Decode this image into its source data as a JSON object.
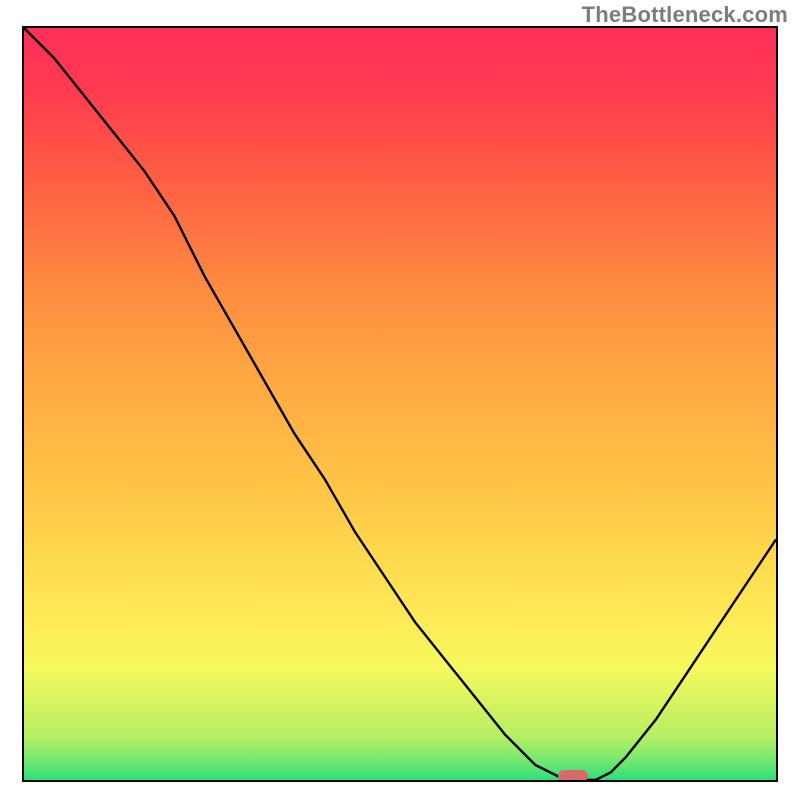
{
  "watermark": "TheBottleneck.com",
  "colors": {
    "curve": "#000000",
    "marker": "#d46a6a",
    "border": "#000000"
  },
  "chart_data": {
    "type": "line",
    "title": "",
    "xlabel": "",
    "ylabel": "",
    "xlim": [
      0,
      100
    ],
    "ylim": [
      0,
      100
    ],
    "x": [
      0,
      4,
      8,
      12,
      16,
      20,
      24,
      28,
      32,
      36,
      40,
      44,
      48,
      52,
      56,
      60,
      64,
      66,
      68,
      70,
      72,
      74,
      76,
      78,
      80,
      84,
      88,
      92,
      96,
      100
    ],
    "y": [
      100,
      96,
      91,
      86,
      81,
      75,
      67,
      60,
      53,
      46,
      40,
      33,
      27,
      21,
      16,
      11,
      6,
      4,
      2,
      1,
      0,
      0,
      0,
      1,
      3,
      8,
      14,
      20,
      26,
      32
    ],
    "marker": {
      "x": 73,
      "width": 4,
      "y": 0
    },
    "gradient_stops": [
      {
        "pos": 0,
        "color": "#2de07a"
      },
      {
        "pos": 3,
        "color": "#7ee96e"
      },
      {
        "pos": 6,
        "color": "#b9ef64"
      },
      {
        "pos": 15,
        "color": "#f6f95d"
      },
      {
        "pos": 22,
        "color": "#ffe956"
      },
      {
        "pos": 30,
        "color": "#ffd84d"
      },
      {
        "pos": 40,
        "color": "#ffc246"
      },
      {
        "pos": 52,
        "color": "#ffab42"
      },
      {
        "pos": 64,
        "color": "#ff8f41"
      },
      {
        "pos": 74,
        "color": "#ff7042"
      },
      {
        "pos": 84,
        "color": "#ff5246"
      },
      {
        "pos": 92,
        "color": "#ff3a50"
      },
      {
        "pos": 100,
        "color": "#ff2f5a"
      }
    ]
  }
}
